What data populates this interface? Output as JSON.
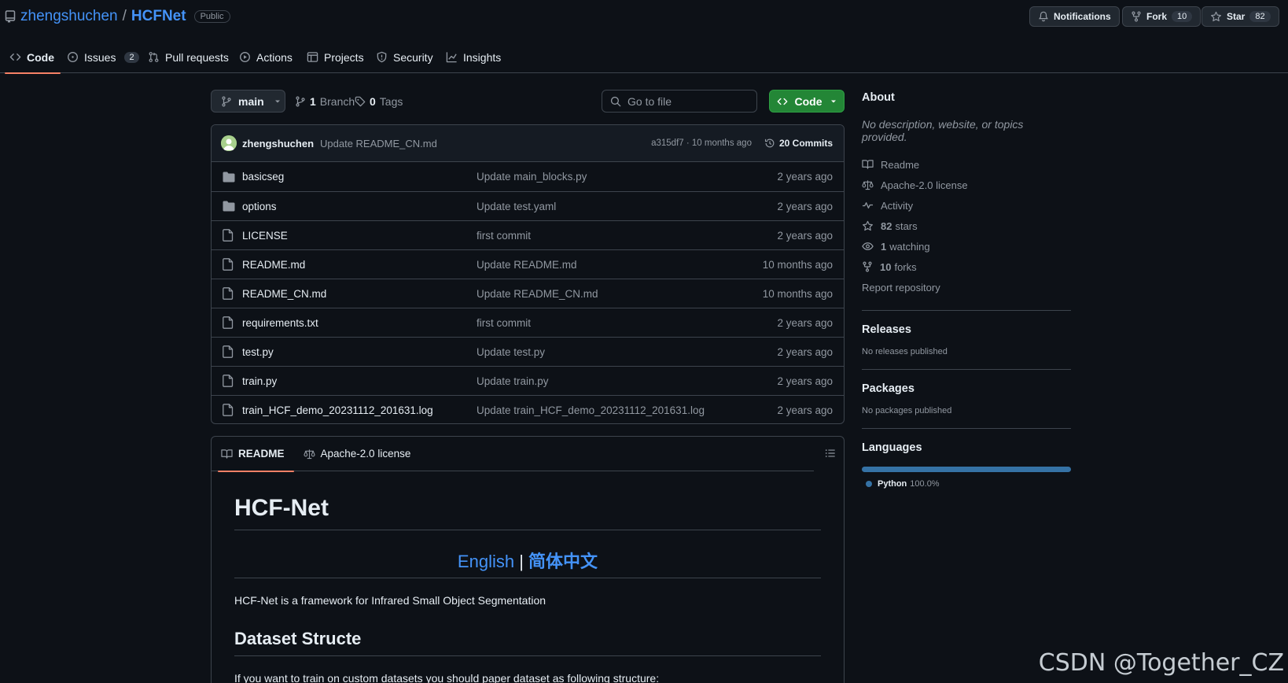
{
  "repo": {
    "owner": "zhengshuchen",
    "separator": "/",
    "name": "HCFNet",
    "visibility": "Public"
  },
  "header_actions": {
    "notifications_label": "Notifications",
    "fork_label": "Fork",
    "fork_count": "10",
    "star_label": "Star",
    "star_count": "82"
  },
  "nav": {
    "code": "Code",
    "issues": "Issues",
    "issues_count": "2",
    "pulls": "Pull requests",
    "actions": "Actions",
    "projects": "Projects",
    "security": "Security",
    "insights": "Insights"
  },
  "branch_bar": {
    "branch": "main",
    "branch_count": "1",
    "branch_label": "Branch",
    "tag_count": "0",
    "tag_label": "Tags",
    "goto_placeholder": "Go to file",
    "code_button": "Code"
  },
  "latest_commit": {
    "author": "zhengshuchen",
    "message": "Update README_CN.md",
    "hash_and_time": "a315df7 · 10 months ago",
    "commits_label": "20 Commits"
  },
  "files": [
    {
      "type": "folder",
      "name": "basicseg",
      "message": "Update main_blocks.py",
      "date": "2 years ago"
    },
    {
      "type": "folder",
      "name": "options",
      "message": "Update test.yaml",
      "date": "2 years ago"
    },
    {
      "type": "file",
      "name": "LICENSE",
      "message": "first commit",
      "date": "2 years ago"
    },
    {
      "type": "file",
      "name": "README.md",
      "message": "Update README.md",
      "date": "10 months ago"
    },
    {
      "type": "file",
      "name": "README_CN.md",
      "message": "Update README_CN.md",
      "date": "10 months ago"
    },
    {
      "type": "file",
      "name": "requirements.txt",
      "message": "first commit",
      "date": "2 years ago"
    },
    {
      "type": "file",
      "name": "test.py",
      "message": "Update test.py",
      "date": "2 years ago"
    },
    {
      "type": "file",
      "name": "train.py",
      "message": "Update train.py",
      "date": "2 years ago"
    },
    {
      "type": "file",
      "name": "train_HCF_demo_20231112_201631.log",
      "message": "Update train_HCF_demo_20231112_201631.log",
      "date": "2 years ago"
    }
  ],
  "readme": {
    "tab_readme": "README",
    "tab_license": "Apache-2.0 license",
    "title": "HCF-Net",
    "lang_english": "English",
    "lang_divider": "|",
    "lang_chinese": "简体中文",
    "intro": "HCF-Net is a framework for Infrared Small Object Segmentation",
    "section_title": "Dataset Structe",
    "section_text": "If you want to train on custom datasets you should paper dataset as following structure:"
  },
  "about": {
    "heading": "About",
    "description": "No description, website, or topics provided.",
    "readme": "Readme",
    "license": "Apache-2.0 license",
    "activity": "Activity",
    "stars_count": "82",
    "stars_label": "stars",
    "watching_count": "1",
    "watching_label": "watching",
    "forks_count": "10",
    "forks_label": "forks",
    "report": "Report repository"
  },
  "releases": {
    "heading": "Releases",
    "text": "No releases published"
  },
  "packages": {
    "heading": "Packages",
    "text": "No packages published"
  },
  "languages": {
    "heading": "Languages",
    "items": [
      {
        "name": "Python",
        "percent": "100.0%",
        "color": "#3572a5"
      }
    ]
  },
  "watermark": "CSDN @Together_CZ",
  "colors": {
    "accent": "#4493f8",
    "primary_button": "#238636",
    "tab_underline": "#f78166",
    "background": "#0d1117"
  }
}
